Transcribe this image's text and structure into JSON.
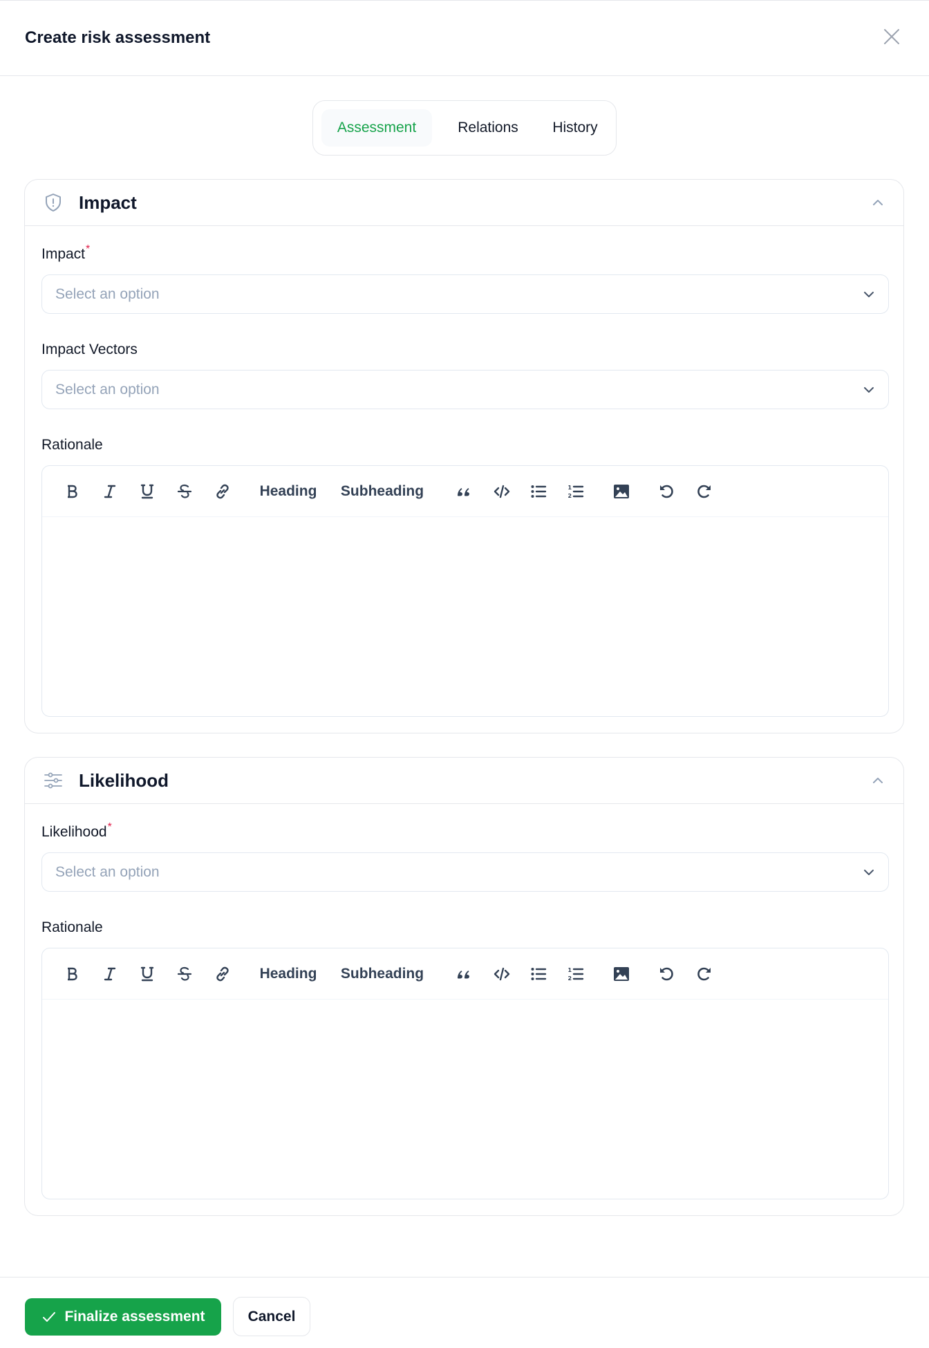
{
  "dialog": {
    "title": "Create risk assessment",
    "close_icon": "close-icon"
  },
  "tabs": [
    {
      "label": "Assessment",
      "active": true
    },
    {
      "label": "Relations",
      "active": false
    },
    {
      "label": "History",
      "active": false
    }
  ],
  "colors": {
    "accent": "#16a34a",
    "required": "#e11d48",
    "placeholder": "#94a3b8",
    "border": "#e5e7eb"
  },
  "impact_section": {
    "title": "Impact",
    "icon": "shield-alert-icon",
    "collapse_icon": "chevron-up-icon",
    "fields": {
      "impact": {
        "label": "Impact",
        "required_mark": "*",
        "placeholder": "Select an option",
        "value": ""
      },
      "impact_vectors": {
        "label": "Impact Vectors",
        "placeholder": "Select an option",
        "value": ""
      },
      "rationale": {
        "label": "Rationale",
        "value": ""
      }
    }
  },
  "likelihood_section": {
    "title": "Likelihood",
    "icon": "sliders-icon",
    "collapse_icon": "chevron-up-icon",
    "fields": {
      "likelihood": {
        "label": "Likelihood",
        "required_mark": "*",
        "placeholder": "Select an option",
        "value": ""
      },
      "rationale": {
        "label": "Rationale",
        "value": ""
      }
    }
  },
  "editor_toolbar": {
    "bold": "bold-icon",
    "italic": "italic-icon",
    "underline": "underline-icon",
    "strikethrough": "strikethrough-icon",
    "link": "link-icon",
    "heading_label": "Heading",
    "subheading_label": "Subheading",
    "quote": "quote-icon",
    "code": "code-icon",
    "bullet_list": "bullet-list-icon",
    "ordered_list": "ordered-list-icon",
    "image": "image-icon",
    "undo": "undo-icon",
    "redo": "redo-icon"
  },
  "footer": {
    "finalize_label": "Finalize assessment",
    "finalize_icon": "check-icon",
    "cancel_label": "Cancel"
  }
}
